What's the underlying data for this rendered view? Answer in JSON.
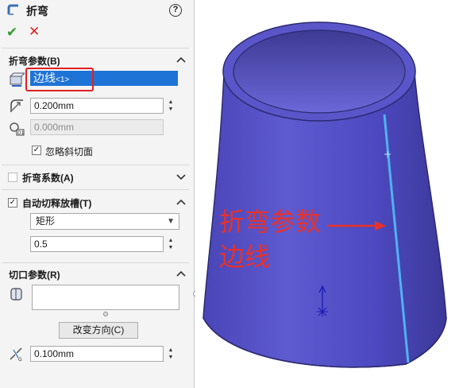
{
  "panel": {
    "title": "折弯",
    "help_label": "?",
    "ok_label": "✔",
    "cancel_label": "✕",
    "bend_params": {
      "title": "折弯参数(B)",
      "edge_selection": "边线",
      "edge_selection_index": "<1>",
      "radius_value": "0.200mm",
      "kfactor_value": "0.000mm",
      "ignore_bevel_label": "忽略斜切面",
      "ignore_bevel_checked": true
    },
    "bend_allowance": {
      "title": "折弯系数(A)",
      "checked": false
    },
    "auto_relief": {
      "title": "自动切释放槽(T)",
      "checked": true,
      "type_value": "矩形",
      "ratio_value": "0.5"
    },
    "rip_params": {
      "title": "切口参数(R)",
      "edges_value": "",
      "reverse_button_label": "改变方向(C)",
      "gap_value": "0.100mm"
    }
  },
  "viewport": {
    "annotation_line1": "折弯参数",
    "annotation_line2": "边线",
    "model_color": "#5a56c9",
    "edge_highlight_color": "#4fb3f0",
    "annotation_color": "#e8312a"
  }
}
